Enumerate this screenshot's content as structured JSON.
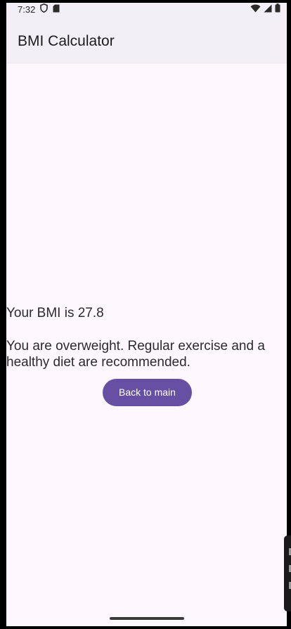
{
  "status_bar": {
    "time": "7:32",
    "left_icons": [
      "shield-icon",
      "sim-card-icon"
    ],
    "right_icons": [
      "wifi-icon",
      "cellular-signal-icon",
      "battery-icon"
    ]
  },
  "app_bar": {
    "title": "BMI Calculator",
    "background": "#F3EFF6"
  },
  "result": {
    "bmi_text": "Your BMI is 27.8",
    "advice_text": "You are overweight. Regular exercise and a healthy diet are recommended."
  },
  "actions": {
    "back_label": "Back to main",
    "button_color": "#6750A4"
  },
  "colors": {
    "background": "#FFF7FE",
    "text": "#2B2A2E",
    "on_primary": "#FFFFFF"
  }
}
